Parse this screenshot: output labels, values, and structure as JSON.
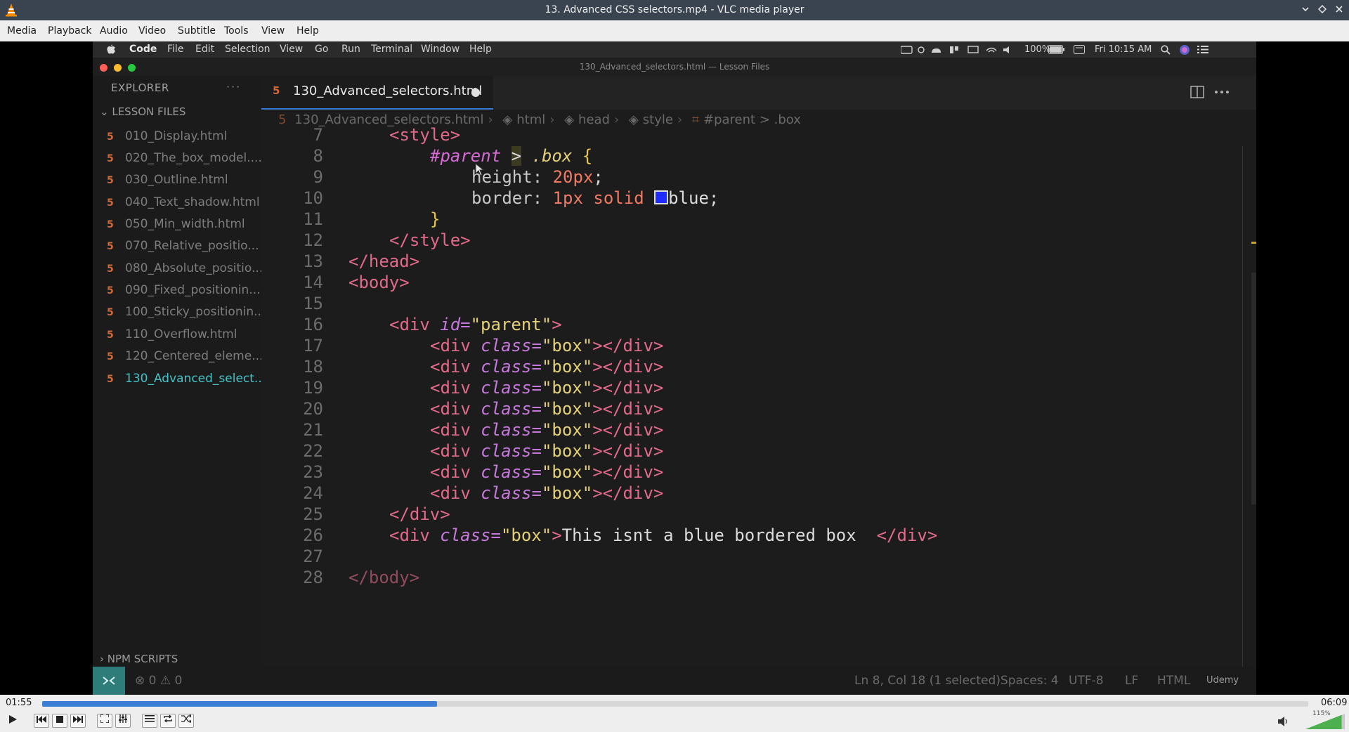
{
  "window": {
    "title": "13. Advanced CSS selectors.mp4 - VLC media player",
    "controls": [
      "chevron-down-icon",
      "restore-icon",
      "close-icon"
    ]
  },
  "menu": [
    "Media",
    "Playback",
    "Audio",
    "Video",
    "Subtitle",
    "Tools",
    "View",
    "Help"
  ],
  "mac_menubar": {
    "app": "Code",
    "items": [
      "File",
      "Edit",
      "Selection",
      "View",
      "Go",
      "Run",
      "Terminal",
      "Window",
      "Help"
    ],
    "battery": "100%",
    "clock": "Fri 10:15 AM"
  },
  "vscode": {
    "window_title": "130_Advanced_selectors.html — Lesson Files",
    "explorer": {
      "header": "EXPLORER",
      "more": "···",
      "section": "LESSON FILES",
      "files": [
        "010_Display.html",
        "020_The_box_model....",
        "030_Outline.html",
        "040_Text_shadow.html",
        "050_Min_width.html",
        "070_Relative_positio...",
        "080_Absolute_positio...",
        "090_Fixed_positionin...",
        "100_Sticky_positionin...",
        "110_Overflow.html",
        "120_Centered_eleme...",
        "130_Advanced_select..."
      ],
      "npm": "NPM SCRIPTS"
    },
    "tab": {
      "name": "130_Advanced_selectors.html",
      "modified": "●",
      "icon": "5"
    },
    "breadcrumb": [
      "130_Advanced_selectors.html",
      "html",
      "head",
      "style",
      "#parent > .box"
    ],
    "line_numbers": [
      "7",
      "8",
      "9",
      "10",
      "11",
      "12",
      "13",
      "14",
      "15",
      "16",
      "17",
      "18",
      "19",
      "20",
      "21",
      "22",
      "23",
      "24",
      "25",
      "26",
      "27",
      "28"
    ],
    "code": {
      "l7_tag": "<style>",
      "l8_sel": "#parent",
      "l8_comb": ">",
      "l8_cls": ".box",
      "l8_brace": "{",
      "l9_prop": "height:",
      "l9_val": "20px",
      "l9_semi": ";",
      "l10_prop": "border:",
      "l10_val": "1px solid",
      "l10_blue": "blue",
      "l10_semi": ";",
      "l11_brace": "}",
      "l12": "</style>",
      "l13": "</head>",
      "l14": "<body>",
      "l16_open": "<div",
      "l16_attr": "id=",
      "l16_val": "\"parent\"",
      "l16_close": ">",
      "box_open": "<div",
      "box_attr": "class=",
      "box_val": "\"box\"",
      "box_close": "></div>",
      "l25": "</div>",
      "l26_val": "\"box\"",
      "l26_text": "This isnt a blue bordered box  ",
      "l26_close": "</div>",
      "l28": "</body>"
    },
    "status": {
      "problems": "⊗ 0 ⚠ 0",
      "position": "Ln 8, Col 18 (1 selected)",
      "spaces": "Spaces: 4",
      "encoding": "UTF-8",
      "eol": "LF",
      "language": "HTML",
      "watermark": "Udemy"
    }
  },
  "player": {
    "elapsed": "01:55",
    "total": "06:09",
    "progress": 0.312,
    "volume": "115%",
    "volume_level": 1.15,
    "colors": {
      "progress": "#3b7ed4",
      "volume": "#4caf50"
    }
  }
}
